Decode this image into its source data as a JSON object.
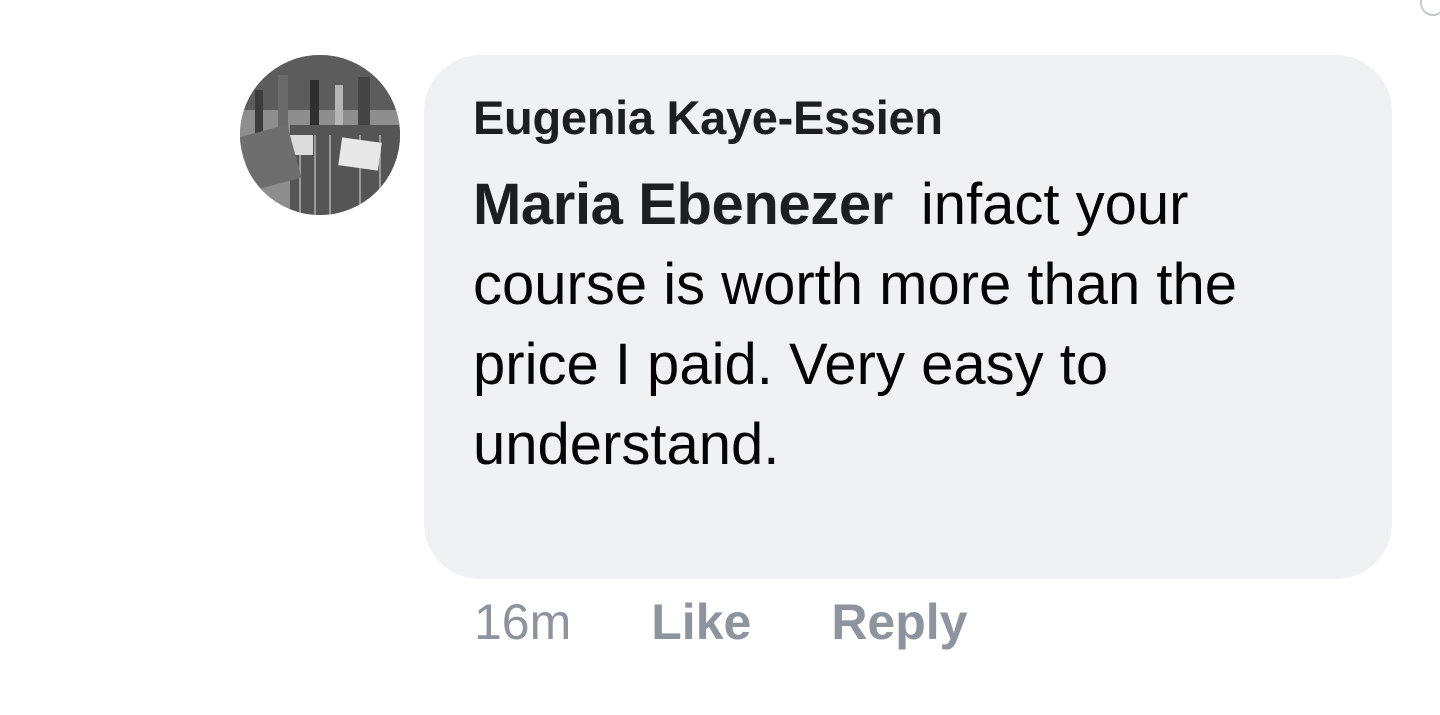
{
  "comment": {
    "author": "Eugenia Kaye-Essien",
    "mention": "Maria Ebenezer",
    "text": "infact your course is worth more than the price I paid. Very easy to understand."
  },
  "actions": {
    "timestamp": "16m",
    "like_label": "Like",
    "reply_label": "Reply"
  },
  "colors": {
    "bubble_bg": "#f0f1f5",
    "author_text": "#1c1e21",
    "action_text": "#8d949e"
  }
}
